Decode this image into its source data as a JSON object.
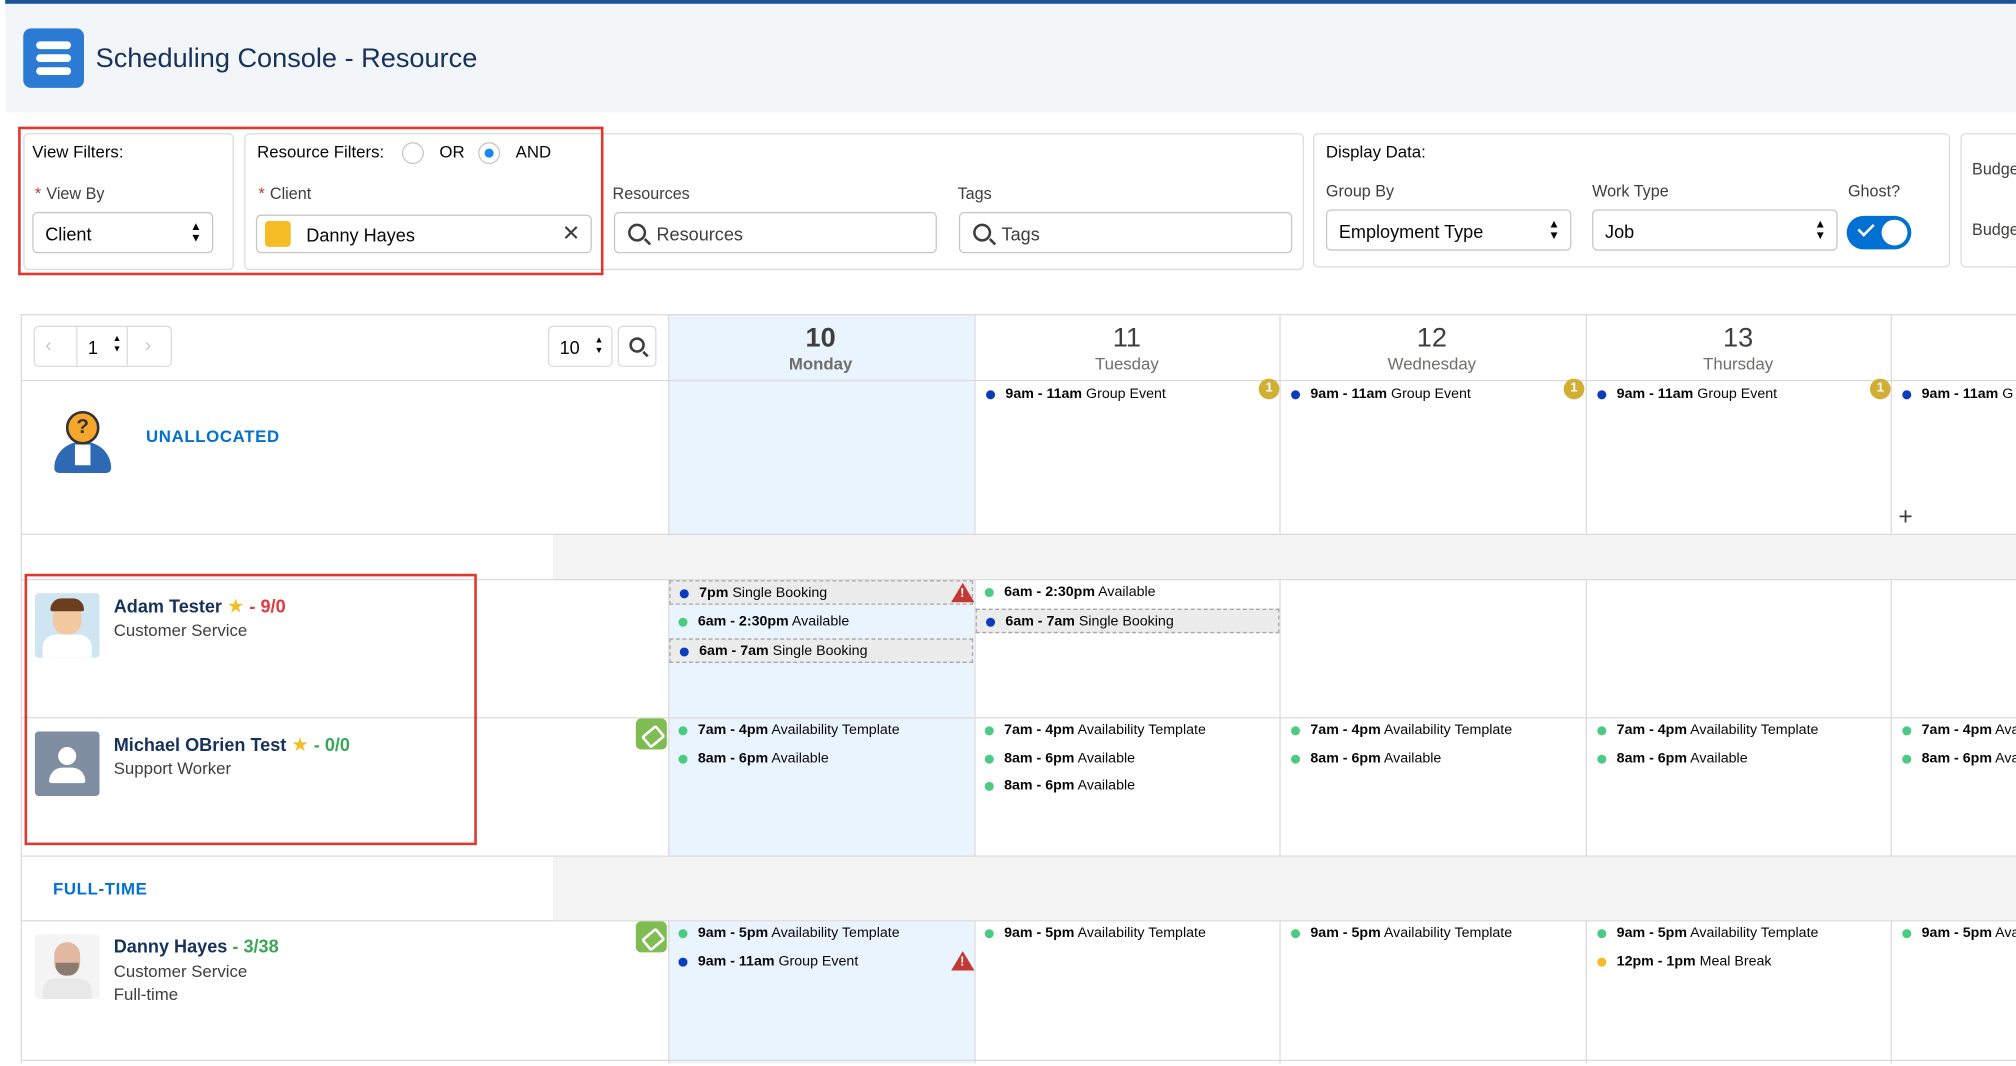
{
  "header": {
    "title": "Scheduling Console - Resource"
  },
  "view_filters": {
    "label": "View Filters:",
    "view_by_label": "View By",
    "view_by_value": "Client"
  },
  "resource_filters": {
    "label": "Resource Filters:",
    "or_label": "OR",
    "and_label": "AND",
    "selected": "AND",
    "client_label": "Client",
    "client_value": "Danny Hayes",
    "resources_label": "Resources",
    "resources_placeholder": "Resources",
    "tags_label": "Tags",
    "tags_placeholder": "Tags"
  },
  "display_data": {
    "label": "Display Data:",
    "group_by_label": "Group By",
    "group_by_value": "Employment Type",
    "work_type_label": "Work Type",
    "work_type_value": "Job",
    "ghost_label": "Ghost?",
    "ghost_on": true,
    "budget_label_1": "Budge",
    "budget_label_2": "Budge"
  },
  "pager": {
    "page": "1",
    "page_size": "10"
  },
  "days": [
    {
      "num": "10",
      "name": "Monday"
    },
    {
      "num": "11",
      "name": "Tuesday"
    },
    {
      "num": "12",
      "name": "Wednesday"
    },
    {
      "num": "13",
      "name": "Thursday"
    }
  ],
  "sections": {
    "unallocated": "UNALLOCATED",
    "full_time": "FULL-TIME"
  },
  "unallocated_events": [
    {
      "time": "9am - 11am",
      "label": "Group Event",
      "badge": "1"
    },
    {
      "time": "9am - 11am",
      "label": "Group Event",
      "badge": "1"
    },
    {
      "time": "9am - 11am",
      "label": "Group Event",
      "badge": "1"
    },
    {
      "time": "9am - 11am",
      "label": "G"
    }
  ],
  "resources": [
    {
      "name": "Adam Tester",
      "count": "- 9/0",
      "role": "Customer Service",
      "events": {
        "mon": [
          {
            "time": "7pm",
            "label": "Single Booking"
          },
          {
            "time": "6am - 2:30pm",
            "label": "Available"
          },
          {
            "time": "6am - 7am",
            "label": "Single Booking"
          }
        ],
        "tue": [
          {
            "time": "6am - 2:30pm",
            "label": "Available"
          },
          {
            "time": "6am - 7am",
            "label": "Single Booking"
          }
        ]
      }
    },
    {
      "name": "Michael OBrien Test",
      "count": "- 0/0",
      "role": "Support Worker",
      "events": {
        "mon": [
          {
            "time": "7am - 4pm",
            "label": "Availability Template"
          },
          {
            "time": "8am - 6pm",
            "label": "Available"
          }
        ],
        "tue": [
          {
            "time": "7am - 4pm",
            "label": "Availability Template"
          },
          {
            "time": "8am - 6pm",
            "label": "Available"
          },
          {
            "time": "8am - 6pm",
            "label": "Available"
          }
        ],
        "wed": [
          {
            "time": "7am - 4pm",
            "label": "Availability Template"
          },
          {
            "time": "8am - 6pm",
            "label": "Available"
          }
        ],
        "thu": [
          {
            "time": "7am - 4pm",
            "label": "Availability Template"
          },
          {
            "time": "8am - 6pm",
            "label": "Available"
          }
        ],
        "fri": [
          {
            "time": "7am - 4pm",
            "label": "Ava"
          },
          {
            "time": "8am - 6pm",
            "label": "Ava"
          }
        ]
      }
    },
    {
      "name": "Danny Hayes",
      "count": "- 3/38",
      "role": "Customer Service",
      "role2": "Full-time",
      "events": {
        "mon": [
          {
            "time": "9am - 5pm",
            "label": "Availability Template"
          },
          {
            "time": "9am - 11am",
            "label": "Group Event"
          }
        ],
        "tue": [
          {
            "time": "9am - 5pm",
            "label": "Availability Template"
          }
        ],
        "wed": [
          {
            "time": "9am - 5pm",
            "label": "Availability Template"
          }
        ],
        "thu": [
          {
            "time": "9am - 5pm",
            "label": "Availability Template"
          },
          {
            "time": "12pm - 1pm",
            "label": "Meal Break"
          }
        ],
        "fri": [
          {
            "time": "9am - 5pm",
            "label": "Ava"
          }
        ]
      }
    }
  ],
  "colors": {
    "brand": "#2b7bd5",
    "accent": "#0070d2",
    "warning": "#c23934",
    "highlight_box": "#e0382f"
  }
}
